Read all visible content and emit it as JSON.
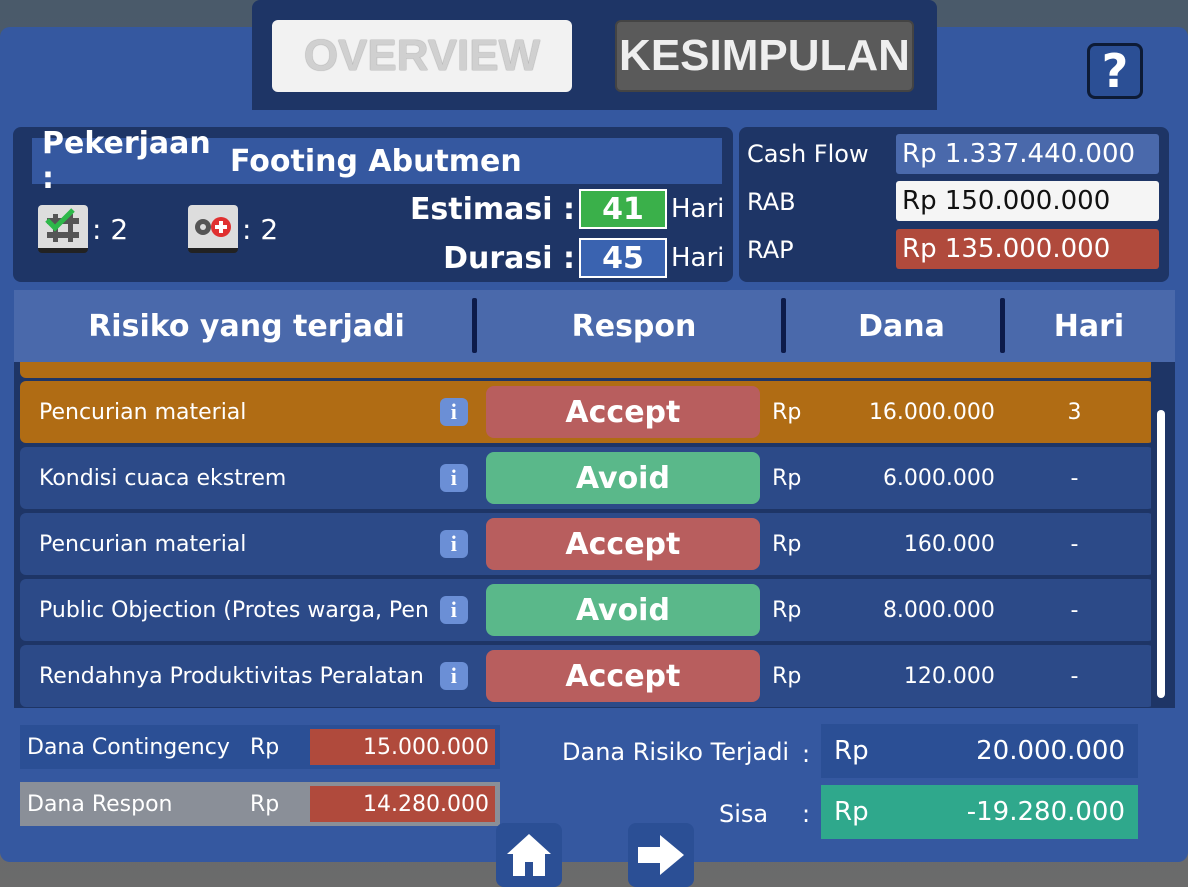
{
  "tabs": {
    "overview": "OVERVIEW",
    "kesimpulan": "KESIMPULAN"
  },
  "help": {
    "label": "?"
  },
  "job": {
    "label": "Pekerjaan :",
    "name": "Footing Abutmen",
    "completed_count": ": 2",
    "issue_count": ": 2",
    "estimasi_label": "Estimasi :",
    "estimasi_value": "41",
    "durasi_label": "Durasi :",
    "durasi_value": "45",
    "unit": "Hari"
  },
  "finance": {
    "cashflow_label": "Cash Flow",
    "cashflow_value": "Rp 1.337.440.000",
    "rab_label": "RAB",
    "rab_value": "Rp 150.000.000",
    "rap_label": "RAP",
    "rap_value": "Rp 135.000.000"
  },
  "table": {
    "headers": [
      "Risiko yang terjadi",
      "Respon",
      "Dana",
      "Hari"
    ],
    "rows": [
      {
        "risk": "Pencurian material",
        "response": "Accept",
        "currency": "Rp",
        "dana": "16.000.000",
        "hari": "3"
      },
      {
        "risk": "Kondisi cuaca ekstrem",
        "response": "Avoid",
        "currency": "Rp",
        "dana": "6.000.000",
        "hari": "-"
      },
      {
        "risk": "Pencurian material",
        "response": "Accept",
        "currency": "Rp",
        "dana": "160.000",
        "hari": "-"
      },
      {
        "risk": "Public Objection (Protes warga, Penu",
        "response": "Avoid",
        "currency": "Rp",
        "dana": "8.000.000",
        "hari": "-"
      },
      {
        "risk": "Rendahnya Produktivitas Peralatan",
        "response": "Accept",
        "currency": "Rp",
        "dana": "120.000",
        "hari": "-"
      }
    ]
  },
  "summary": {
    "contingency_label": "Dana Contingency",
    "contingency_currency": "Rp",
    "contingency_value": "15.000.000",
    "respon_label": "Dana Respon",
    "respon_currency": "Rp",
    "respon_value": "14.280.000",
    "risk_label": "Dana Risiko Terjadi",
    "risk_colon": ":",
    "risk_currency": "Rp",
    "risk_value": "20.000.000",
    "sisa_label": "Sisa",
    "sisa_colon": ":",
    "sisa_currency": "Rp",
    "sisa_value": "-19.280.000"
  },
  "colors": {
    "accept": "#b85e5e",
    "avoid": "#5ab88a",
    "highlight_row": "#b06c14",
    "panel": "#1e3566",
    "estimasi_box": "#3ab04a",
    "durasi_box": "#3a63b0"
  },
  "icons": {
    "home": "home-icon",
    "next": "arrow-right-icon",
    "info": "info-icon"
  }
}
